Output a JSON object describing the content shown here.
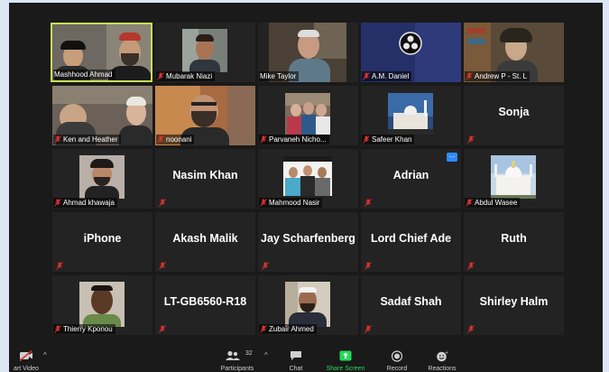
{
  "participants": [
    {
      "name": "Mashhood Ahmad"
    },
    {
      "name": "Mubarak Niazi"
    },
    {
      "name": "Mike Taylor"
    },
    {
      "name": "A.M. Daniel"
    },
    {
      "name": "Andrew P - St. L"
    },
    {
      "name": "Ken and Heather"
    },
    {
      "name": "noonani"
    },
    {
      "name": "Parvaneh Nicho..."
    },
    {
      "name": "Safeer Khan"
    },
    {
      "name": "Sonja"
    },
    {
      "name": "Ahmad khawaja"
    },
    {
      "name": "Nasim Khan"
    },
    {
      "name": "Mahmood Nasir"
    },
    {
      "name": "Adrian"
    },
    {
      "name": "Abdul Wasee"
    },
    {
      "name": "iPhone"
    },
    {
      "name": "Akash Malik"
    },
    {
      "name": "Jay Scharfenberg"
    },
    {
      "name": "Lord Chief Ade"
    },
    {
      "name": "Ruth"
    },
    {
      "name": "Thierry Kponou"
    },
    {
      "name": "LT-GB6560-R18"
    },
    {
      "name": "Zubair Ahmed"
    },
    {
      "name": "Sadaf Shah"
    },
    {
      "name": "Shirley Halm"
    }
  ],
  "more_options": "...",
  "toolbar": {
    "start_video": "art Video",
    "participants_label": "Participants",
    "participants_count": "32",
    "chat": "Chat",
    "share_screen": "Share Screen",
    "record": "Record",
    "reactions": "Reactions"
  },
  "colors": {
    "accent_green": "#23d959",
    "active_border": "#c8dd55",
    "muted_red": "#e0322f",
    "tile_bg": "#232323"
  }
}
